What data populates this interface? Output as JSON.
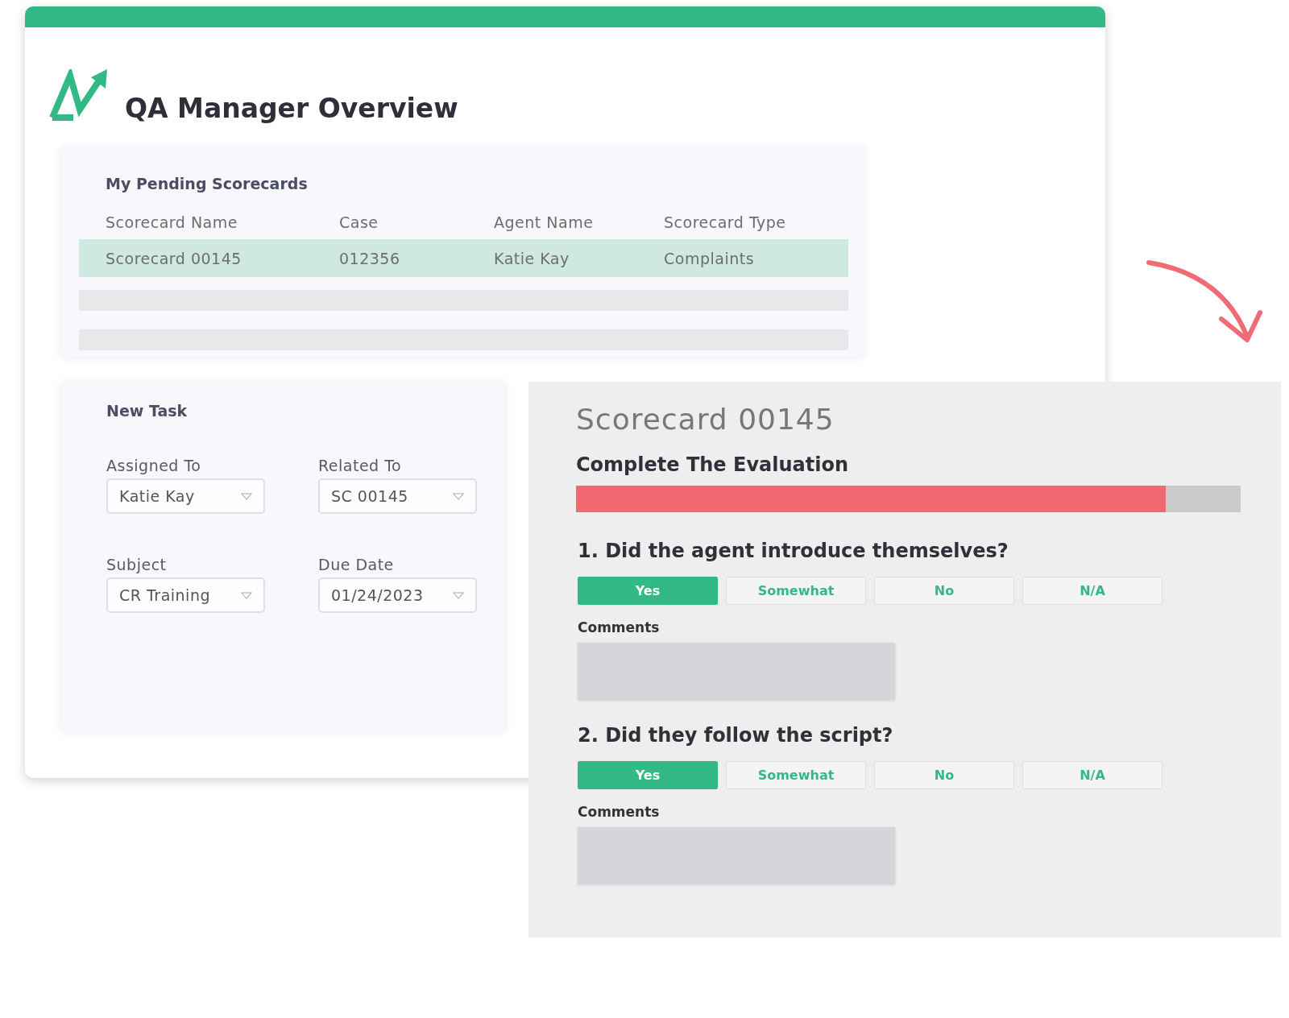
{
  "overview": {
    "title": "QA Manager Overview"
  },
  "pending": {
    "heading": "My Pending Scorecards",
    "columns": [
      "Scorecard Name",
      "Case",
      "Agent Name",
      "Scorecard Type"
    ],
    "rows": [
      {
        "cells": [
          "Scorecard 00145",
          "012356",
          "Katie Kay",
          "Complaints"
        ],
        "selected": true
      }
    ]
  },
  "new_task": {
    "heading": "New Task",
    "fields": [
      {
        "label": "Assigned To",
        "value": "Katie Kay"
      },
      {
        "label": "Related To",
        "value": "SC 00145"
      },
      {
        "label": "Subject",
        "value": "CR Training"
      },
      {
        "label": "Due Date",
        "value": "01/24/2023"
      }
    ]
  },
  "scorecard": {
    "title": "Scorecard 00145",
    "subtitle": "Complete The Evaluation",
    "progress": {
      "level": 0.887
    },
    "questions": [
      {
        "text": "1. Did the agent introduce themselves?",
        "options": [
          {
            "label": "Yes",
            "selected": true
          },
          {
            "label": "Somewhat",
            "selected": false
          },
          {
            "label": "No",
            "selected": false
          },
          {
            "label": "N/A",
            "selected": false
          }
        ],
        "comments_label": "Comments"
      },
      {
        "text": "2. Did they follow the script?",
        "options": [
          {
            "label": "Yes",
            "selected": true
          },
          {
            "label": "Somewhat",
            "selected": false
          },
          {
            "label": "No",
            "selected": false
          },
          {
            "label": "N/A",
            "selected": false
          }
        ],
        "comments_label": "Comments"
      }
    ]
  }
}
